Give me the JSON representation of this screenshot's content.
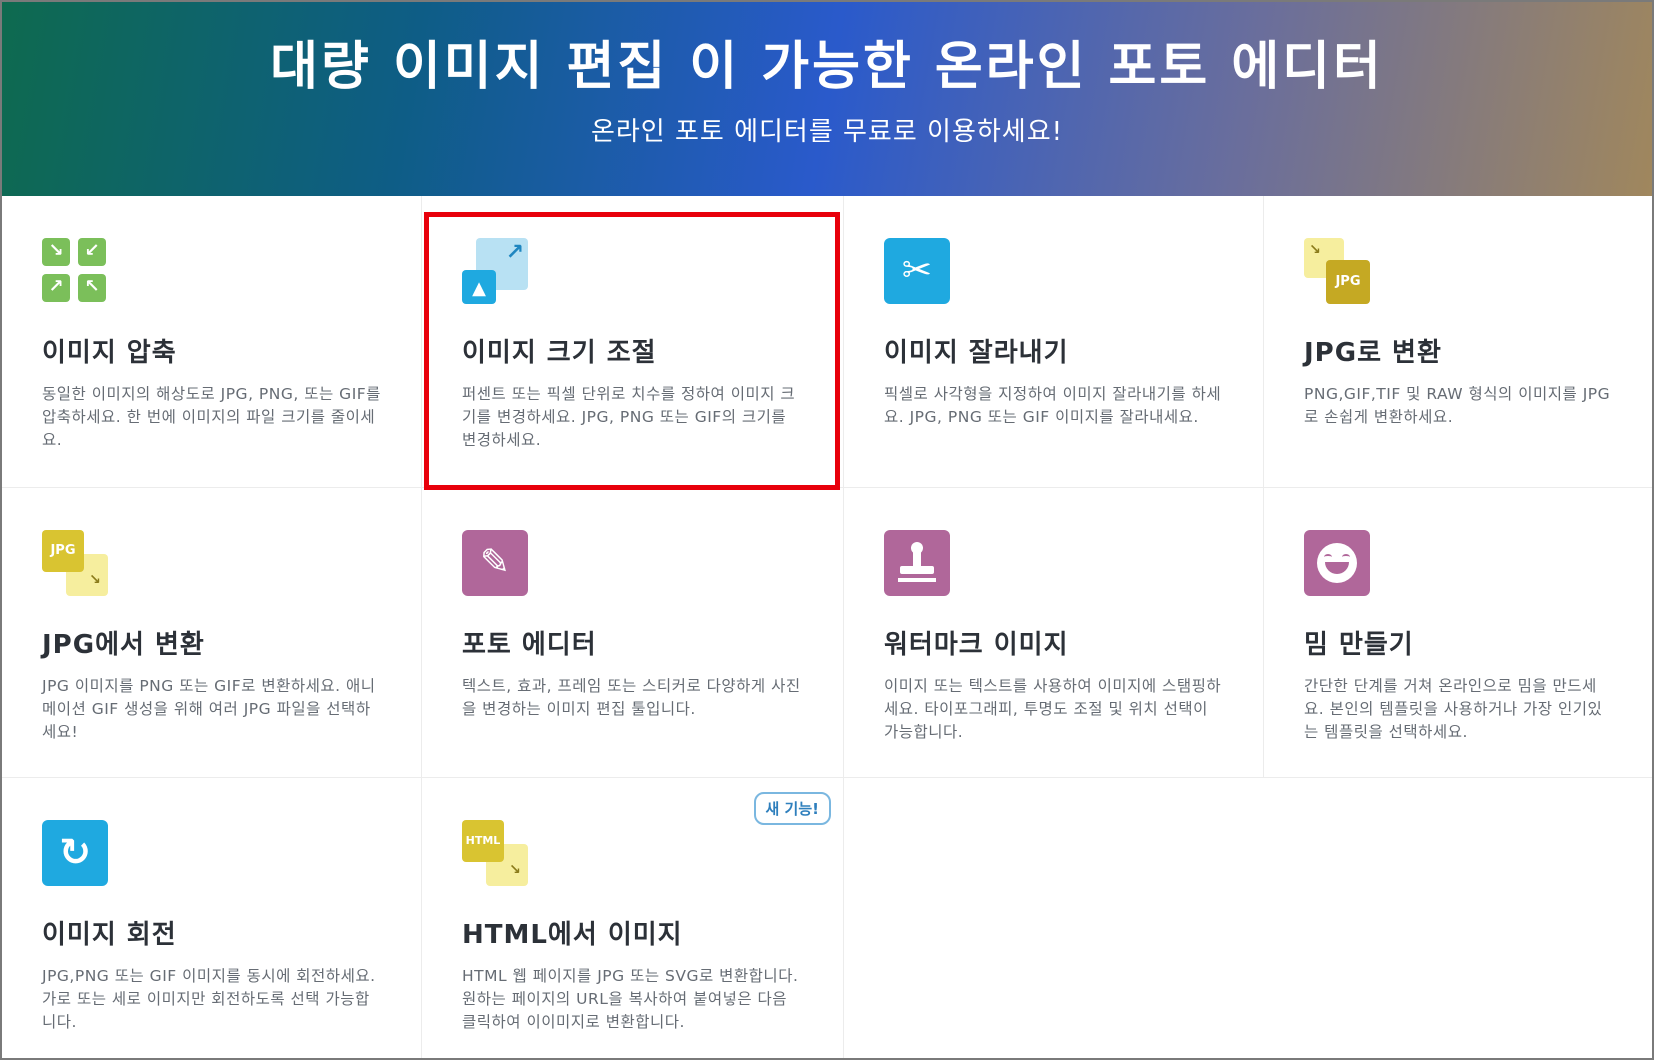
{
  "hero": {
    "title": "대량 이미지 편집 이 가능한 온라인 포토 에디터",
    "subtitle": "온라인 포토 에디터를 무료로 이용하세요!"
  },
  "tools": [
    {
      "title": "이미지 압축",
      "icon": "compress-arrows-icon",
      "desc": "동일한 이미지의 해상도로 JPG, PNG, 또는 GIF를 압축하세요. 한 번에 이미지의 파일 크기를 줄이세요."
    },
    {
      "title": "이미지 크기 조절",
      "icon": "resize-image-icon",
      "desc": "퍼센트 또는 픽셀 단위로 치수를 정하여 이미지 크기를 변경하세요. JPG, PNG 또는 GIF의 크기를 변경하세요."
    },
    {
      "title": "이미지 잘라내기",
      "icon": "scissors-icon",
      "desc": "픽셀로 사각형을 지정하여 이미지 잘라내기를 하세요. JPG, PNG 또는 GIF 이미지를 잘라내세요."
    },
    {
      "title": "JPG로 변환",
      "icon": "convert-to-jpg-icon",
      "icon_text": "JPG",
      "desc": "PNG,GIF,TIF 및 RAW 형식의 이미지를 JPG로 손쉽게 변환하세요."
    },
    {
      "title": "JPG에서 변환",
      "icon": "convert-from-jpg-icon",
      "icon_text": "JPG",
      "desc": "JPG 이미지를 PNG 또는 GIF로 변환하세요. 애니메이션 GIF 생성을 위해 여러 JPG 파일을 선택하세요!"
    },
    {
      "title": "포토 에디터",
      "icon": "pencil-icon",
      "desc": "텍스트, 효과, 프레임 또는 스티커로 다양하게 사진을 변경하는 이미지 편집 툴입니다."
    },
    {
      "title": "워터마크 이미지",
      "icon": "stamp-icon",
      "desc": "이미지 또는 텍스트를 사용하여 이미지에 스탬핑하세요. 타이포그래피, 투명도 조절 및 위치 선택이 가능합니다."
    },
    {
      "title": "밈 만들기",
      "icon": "laughing-face-icon",
      "desc": "간단한 단계를 거쳐 온라인으로 밈을 만드세요. 본인의 템플릿을 사용하거나 가장 인기있는 템플릿을 선택하세요."
    },
    {
      "title": "이미지 회전",
      "icon": "rotate-icon",
      "desc": "JPG,PNG 또는 GIF 이미지를 동시에 회전하세요. 가로 또는 세로 이미지만 회전하도록 선택 가능합니다."
    },
    {
      "title": "HTML에서 이미지",
      "icon": "html-to-image-icon",
      "icon_text": "HTML",
      "badge": "새 기능!",
      "desc": "HTML 웹 페이지를 JPG 또는 SVG로 변환합니다. 원하는 페이지의 URL을 복사하여 붙여넣은 다음 클릭하여 이이미지로 변환합니다."
    }
  ],
  "colors": {
    "green": "#7bbf5a",
    "blue": "#1fa9e0",
    "yellow": "#d9c431",
    "purple": "#b0679a",
    "highlight": "#e8000b"
  }
}
